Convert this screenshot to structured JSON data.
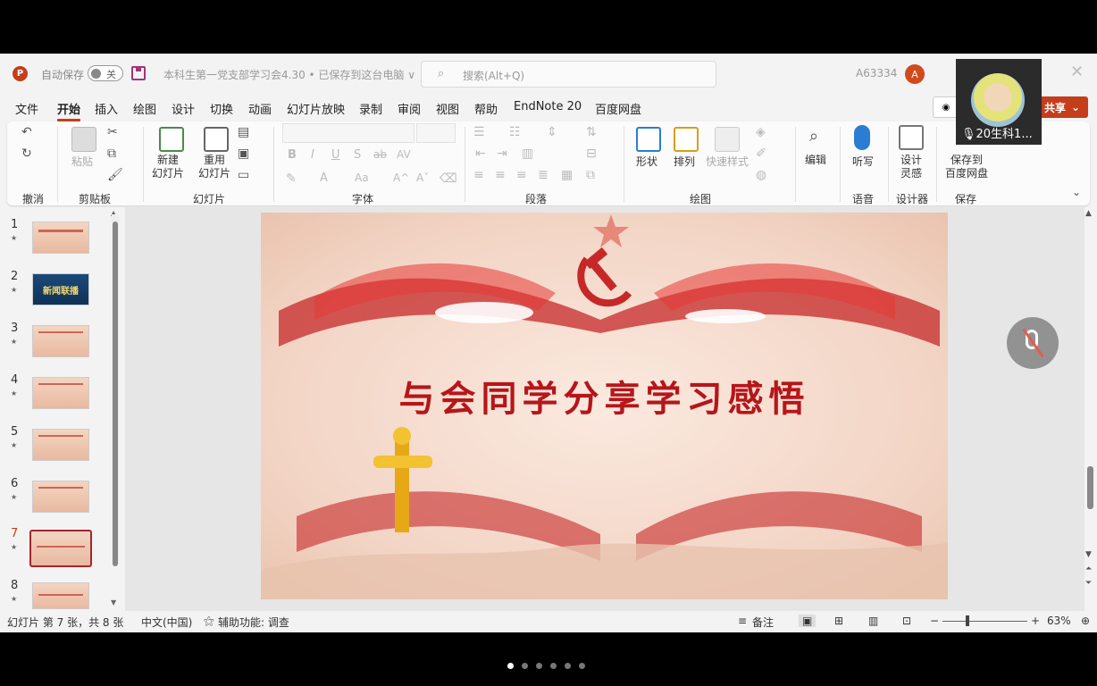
{
  "titlebar": {
    "app_logo": "P",
    "autosave_label": "自动保存",
    "autosave_state": "关",
    "document_title": "本科生第一党支部学习会4.30 • 已保存到这台电脑 ∨",
    "search_placeholder": "搜索(Alt+Q)",
    "account_name": "A63334",
    "avatar_letter": "A",
    "close": "✕"
  },
  "menu": {
    "tabs": [
      "文件",
      "开始",
      "插入",
      "绘图",
      "设计",
      "切换",
      "动画",
      "幻灯片放映",
      "录制",
      "审阅",
      "视图",
      "帮助",
      "EndNote 20",
      "百度网盘"
    ],
    "active_index": 1,
    "share_label": "共享",
    "record_indicator": "录"
  },
  "ribbon": {
    "groups": [
      "撤消",
      "剪贴板",
      "幻灯片",
      "字体",
      "段落",
      "绘图",
      "语音",
      "设计器",
      "保存"
    ],
    "paste_label": "粘贴",
    "new_slide_label": "新建\n幻灯片",
    "reuse_slide_label": "重用\n幻灯片",
    "shapes_label": "形状",
    "arrange_label": "排列",
    "quick_styles_label": "快速样式",
    "edit_label": "编辑",
    "dictate_label": "听写",
    "designer_label": "设计\n灵感",
    "save_baidu_label": "保存到\n百度网盘",
    "font_buttons": [
      "B",
      "I",
      "U",
      "S",
      "ab",
      "AV"
    ],
    "font_buttons_2": [
      "A",
      "Aa",
      "A^",
      "Aˇ"
    ]
  },
  "thumbnails": {
    "slides": [
      {
        "num": "1",
        "star": "★"
      },
      {
        "num": "2",
        "star": "★",
        "thumb_text": "新闻联播"
      },
      {
        "num": "3",
        "star": "★"
      },
      {
        "num": "4",
        "star": "★"
      },
      {
        "num": "5",
        "star": "★"
      },
      {
        "num": "6",
        "star": "★"
      },
      {
        "num": "7",
        "star": "★"
      },
      {
        "num": "8",
        "star": "★"
      }
    ],
    "active_slide": "7"
  },
  "slide": {
    "title": "与会同学分享学习感悟"
  },
  "statusbar": {
    "slide_info": "幻灯片 第 7 张，共 8 张",
    "language": "中文(中国)",
    "accessibility": "辅助功能: 调查",
    "notes": "备注",
    "zoom": "63%",
    "zoom_minus": "−",
    "zoom_plus": "+"
  },
  "video": {
    "participant_name": "20生科1..."
  },
  "carousel": {
    "total": 6,
    "active": 0
  },
  "colors": {
    "accent": "#c43e1c",
    "slide_title": "#b5161b"
  }
}
